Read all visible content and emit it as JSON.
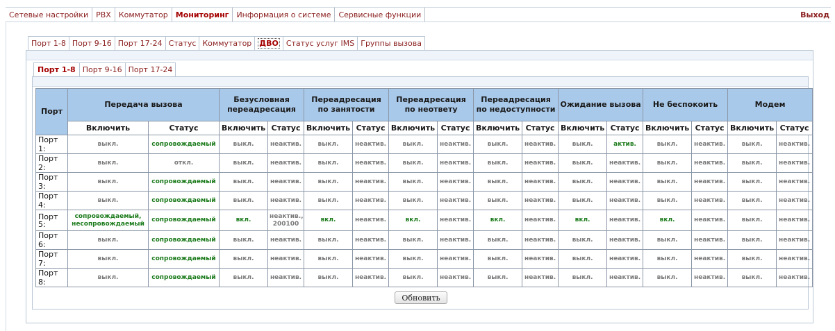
{
  "top_menu": {
    "items": [
      "Сетевые настройки",
      "PBX",
      "Коммутатор",
      "Мониторинг",
      "Информация о системе",
      "Сервисные функции"
    ],
    "active": "Мониторинг",
    "exit": "Выход"
  },
  "sub_tabs": {
    "items": [
      "Порт 1-8",
      "Порт 9-16",
      "Порт 17-24",
      "Статус",
      "Коммутатор",
      "ДВО",
      "Статус услуг IMS",
      "Группы вызова"
    ],
    "active": "ДВО"
  },
  "port_tabs": {
    "items": [
      "Порт 1-8",
      "Порт 9-16",
      "Порт 17-24"
    ],
    "active": "Порт 1-8"
  },
  "table": {
    "port_header": "Порт",
    "groups": [
      "Передача вызова",
      "Безусловная переадресация",
      "Переадресация по занятости",
      "Переадресация по неответу",
      "Переадресация по недоступности",
      "Ожидание вызова",
      "Не беспокоить",
      "Модем"
    ],
    "enable_label": "Включить",
    "status_label": "Статус",
    "rows": [
      {
        "port": "Порт 1:",
        "cells": [
          "выкл.",
          "сопровождаемый",
          "выкл.",
          "неактив.",
          "выкл.",
          "неактив.",
          "выкл.",
          "неактив.",
          "выкл.",
          "неактив.",
          "выкл.",
          "актив.",
          "выкл.",
          "неактив.",
          "выкл.",
          "неактив."
        ]
      },
      {
        "port": "Порт 2:",
        "cells": [
          "выкл.",
          "откл.",
          "выкл.",
          "неактив.",
          "выкл.",
          "неактив.",
          "выкл.",
          "неактив.",
          "выкл.",
          "неактив.",
          "выкл.",
          "неактив.",
          "выкл.",
          "неактив.",
          "выкл.",
          "неактив."
        ]
      },
      {
        "port": "Порт 3:",
        "cells": [
          "выкл.",
          "сопровождаемый",
          "выкл.",
          "неактив.",
          "выкл.",
          "неактив.",
          "выкл.",
          "неактив.",
          "выкл.",
          "неактив.",
          "выкл.",
          "неактив.",
          "выкл.",
          "неактив.",
          "выкл.",
          "неактив."
        ]
      },
      {
        "port": "Порт 4:",
        "cells": [
          "выкл.",
          "сопровождаемый",
          "выкл.",
          "неактив.",
          "выкл.",
          "неактив.",
          "выкл.",
          "неактив.",
          "выкл.",
          "неактив.",
          "выкл.",
          "неактив.",
          "выкл.",
          "неактив.",
          "выкл.",
          "неактив."
        ]
      },
      {
        "port": "Порт 5:",
        "cells": [
          "сопровождаемый, несопровождаемый",
          "сопровождаемый",
          "вкл.",
          "неактив., 200100",
          "вкл.",
          "неактив.",
          "вкл.",
          "неактив.",
          "вкл.",
          "неактив.",
          "вкл.",
          "неактив.",
          "вкл.",
          "неактив.",
          "выкл.",
          "неактив."
        ]
      },
      {
        "port": "Порт 6:",
        "cells": [
          "выкл.",
          "сопровождаемый",
          "выкл.",
          "неактив.",
          "выкл.",
          "неактив.",
          "выкл.",
          "неактив.",
          "выкл.",
          "неактив.",
          "выкл.",
          "неактив.",
          "выкл.",
          "неактив.",
          "выкл.",
          "неактив."
        ]
      },
      {
        "port": "Порт 7:",
        "cells": [
          "выкл.",
          "сопровождаемый",
          "выкл.",
          "неактив.",
          "выкл.",
          "неактив.",
          "выкл.",
          "неактив.",
          "выкл.",
          "неактив.",
          "выкл.",
          "неактив.",
          "выкл.",
          "неактив.",
          "выкл.",
          "неактив."
        ]
      },
      {
        "port": "Порт 8:",
        "cells": [
          "выкл.",
          "сопровождаемый",
          "выкл.",
          "неактив.",
          "выкл.",
          "неактив.",
          "выкл.",
          "неактив.",
          "выкл.",
          "неактив.",
          "выкл.",
          "неактив.",
          "выкл.",
          "неактив.",
          "выкл.",
          "неактив."
        ]
      }
    ]
  },
  "refresh_button": "Обновить",
  "colors": {
    "active_green": "#1c7b1c",
    "inactive_gray": "#7a7a7a",
    "header_blue": "#a9c9ea",
    "menu_red": "#8a1e1e"
  }
}
